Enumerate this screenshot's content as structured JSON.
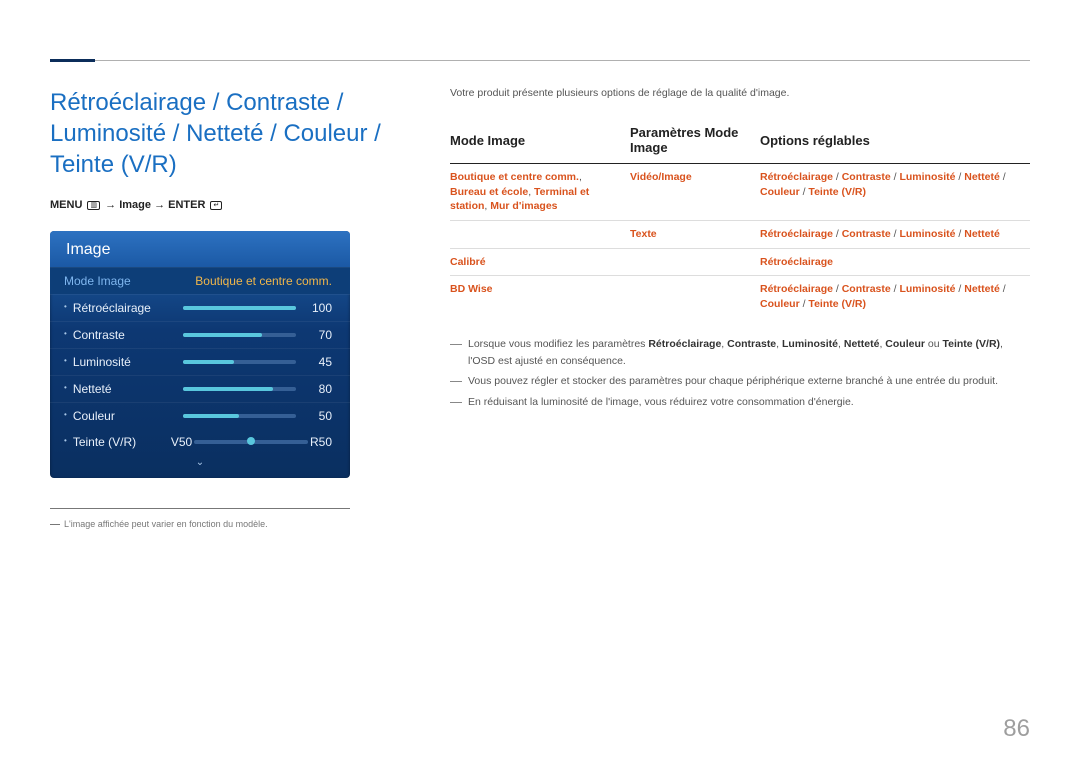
{
  "page_number": "86",
  "heading": "Rétroéclairage / Contraste / Luminosité / Netteté / Couleur / Teinte (V/R)",
  "breadcrumb": {
    "menu": "MENU",
    "arrow": "→",
    "image": "Image",
    "enter": "ENTER"
  },
  "osd": {
    "title": "Image",
    "mode_label": "Mode Image",
    "mode_value": "Boutique et centre comm.",
    "items": [
      {
        "label": "Rétroéclairage",
        "value": "100",
        "pct": 100
      },
      {
        "label": "Contraste",
        "value": "70",
        "pct": 70
      },
      {
        "label": "Luminosité",
        "value": "45",
        "pct": 45
      },
      {
        "label": "Netteté",
        "value": "80",
        "pct": 80
      },
      {
        "label": "Couleur",
        "value": "50",
        "pct": 50
      }
    ],
    "tint": {
      "label": "Teinte (V/R)",
      "left": "V50",
      "right": "R50",
      "pos": 50
    },
    "arrow": "⌄"
  },
  "footnote_small": "L'image affichée peut varier en fonction du modèle.",
  "intro": "Votre produit présente plusieurs options de réglage de la qualité d'image.",
  "table": {
    "head": [
      "Mode Image",
      "Paramètres Mode Image",
      "Options réglables"
    ],
    "rows": [
      {
        "a": "Boutique et centre comm., Bureau et école, Terminal et station, Mur d'images",
        "b": "Vidéo/Image",
        "c": "Rétroéclairage / Contraste / Luminosité / Netteté / Couleur / Teinte (V/R)"
      },
      {
        "a": "",
        "b": "Texte",
        "c": "Rétroéclairage / Contraste / Luminosité / Netteté"
      },
      {
        "a": "Calibré",
        "b": "",
        "c": "Rétroéclairage"
      },
      {
        "a": "BD Wise",
        "b": "",
        "c": "Rétroéclairage / Contraste / Luminosité / Netteté / Couleur / Teinte (V/R)"
      }
    ]
  },
  "notes": [
    "Lorsque vous modifiez les paramètres <b>Rétroéclairage</b>, <b>Contraste</b>, <b>Luminosité</b>, <b>Netteté</b>, <b>Couleur</b> ou <b>Teinte (V/R)</b>, l'OSD est ajusté en conséquence.",
    "Vous pouvez régler et stocker des paramètres pour chaque périphérique externe branché à une entrée du produit.",
    "En réduisant la luminosité de l'image, vous réduirez votre consommation d'énergie."
  ]
}
